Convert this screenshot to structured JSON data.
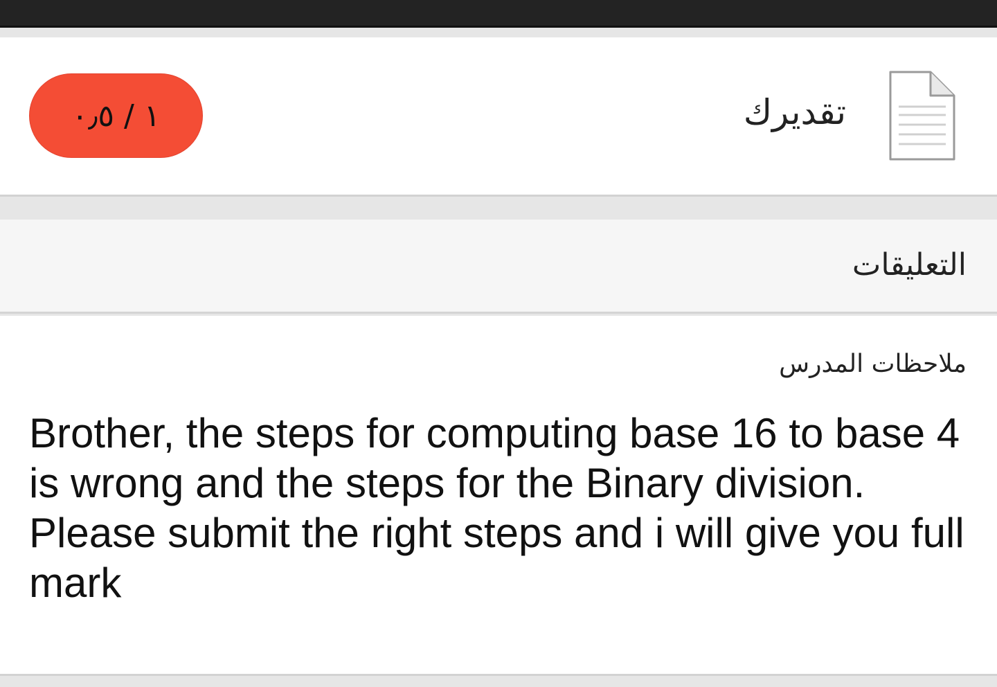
{
  "grade": {
    "label": "تقديرك",
    "score": "١ / ٠٫٥",
    "score_color": "#f44d35"
  },
  "icons": {
    "document": "document-icon"
  },
  "comments": {
    "title": "التعليقات",
    "notes_label": "ملاحظات المدرس",
    "feedback": "Brother, the steps for computing base 16 to base 4 is wrong and the steps for the Binary division. Please submit the right steps and i will give you full mark"
  }
}
